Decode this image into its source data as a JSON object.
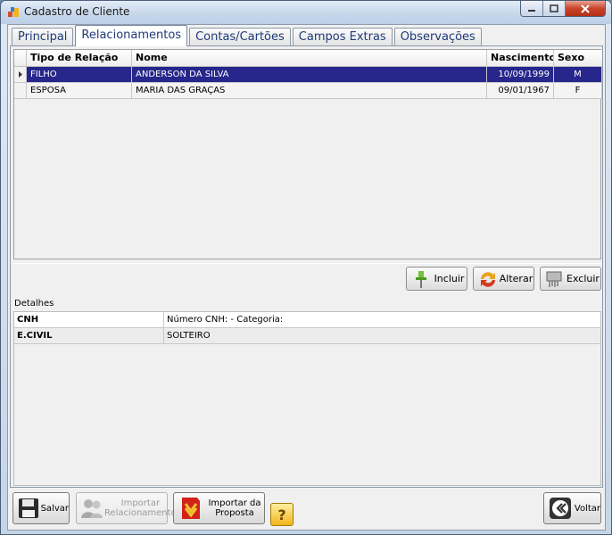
{
  "window": {
    "title": "Cadastro de Cliente",
    "title_icon": "app-icon"
  },
  "tabs": [
    {
      "label": "Principal",
      "active": false
    },
    {
      "label": "Relacionamentos",
      "active": true
    },
    {
      "label": "Contas/Cartões",
      "active": false
    },
    {
      "label": "Campos Extras",
      "active": false
    },
    {
      "label": "Observações",
      "active": false
    }
  ],
  "relationships": {
    "columns": {
      "tipo": "Tipo de Relação",
      "nome": "Nome",
      "nascimento": "Nascimento",
      "sexo": "Sexo"
    },
    "rows": [
      {
        "tipo": "FILHO",
        "nome": "ANDERSON DA SILVA",
        "nascimento": "10/09/1999",
        "sexo": "M",
        "selected": true
      },
      {
        "tipo": "ESPOSA",
        "nome": "MARIA DAS GRAÇAS",
        "nascimento": "09/01/1967",
        "sexo": "F",
        "selected": false
      }
    ]
  },
  "actions": {
    "incluir": "Incluir",
    "alterar": "Alterar",
    "excluir": "Excluir"
  },
  "details": {
    "label": "Detalhes",
    "rows": [
      {
        "key": "CNH",
        "value": "Número CNH:  - Categoria:"
      },
      {
        "key": "E.CIVIL",
        "value": "SOLTEIRO"
      }
    ]
  },
  "footer": {
    "salvar": "Salvar",
    "importar_rel_1": "Importar",
    "importar_rel_2": "Relacionamento",
    "importar_prop_1": "Importar da",
    "importar_prop_2": "Proposta",
    "voltar": "Voltar",
    "help_symbol": "?"
  },
  "colors": {
    "selection": "#26268c",
    "tab_text": "#1f3a78",
    "close_button": "#c7442a",
    "help": "#f2b51c"
  }
}
